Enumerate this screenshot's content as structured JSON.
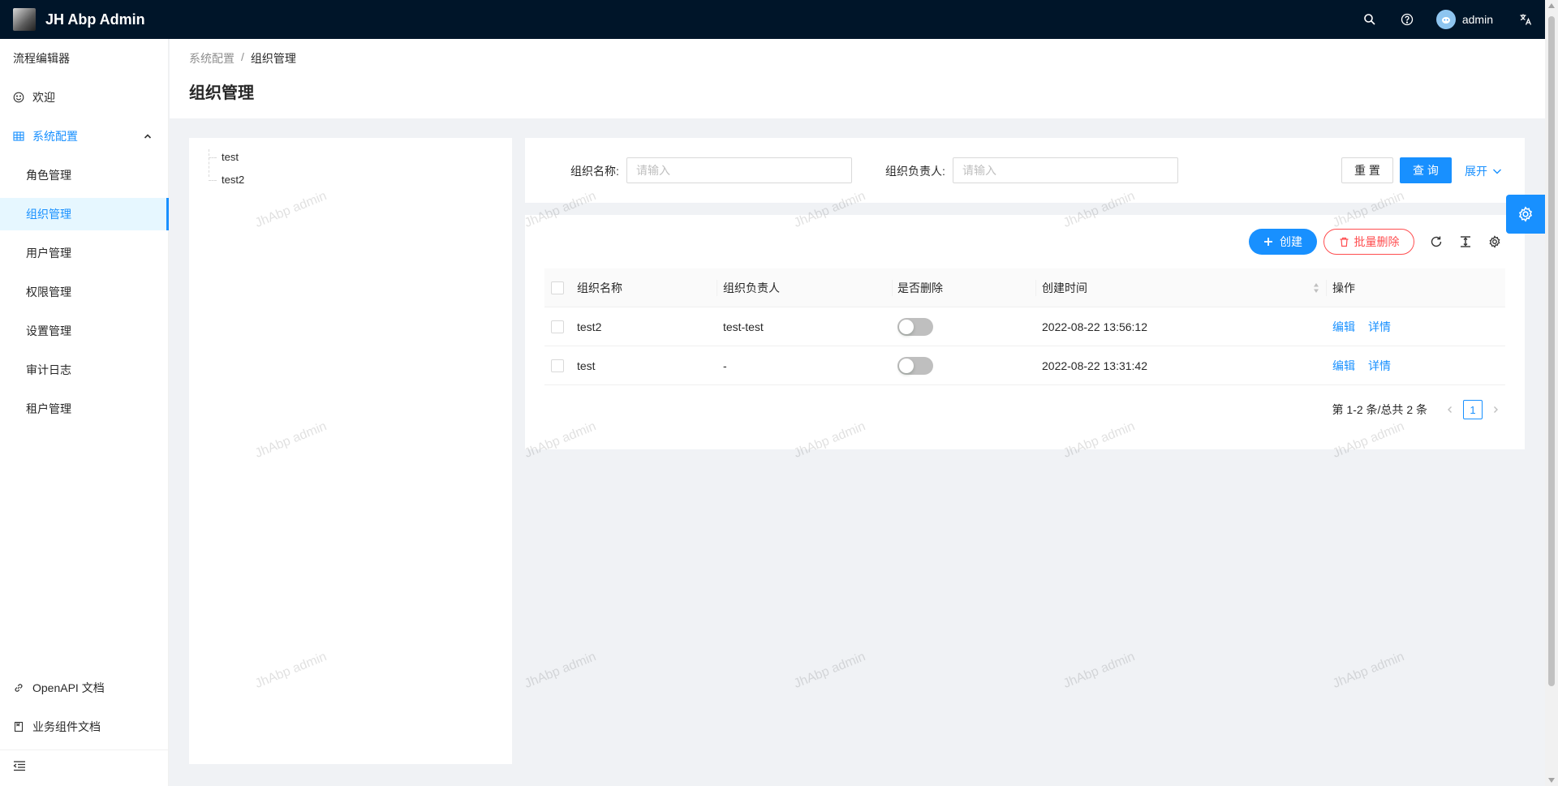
{
  "header": {
    "app_title": "JH Abp Admin",
    "user_name": "admin",
    "icons": [
      "search-icon",
      "question-circle-icon",
      "translate-icon"
    ]
  },
  "sidebar": {
    "items": [
      {
        "label": "流程编辑器",
        "icon": ""
      },
      {
        "label": "欢迎",
        "icon": "smile-icon"
      },
      {
        "label": "系统配置",
        "icon": "table-icon"
      },
      {
        "label": "角色管理"
      },
      {
        "label": "组织管理"
      },
      {
        "label": "用户管理"
      },
      {
        "label": "权限管理"
      },
      {
        "label": "设置管理"
      },
      {
        "label": "审计日志"
      },
      {
        "label": "租户管理"
      }
    ],
    "bottom": [
      {
        "label": "OpenAPI 文档",
        "icon": "link-icon"
      },
      {
        "label": "业务组件文档",
        "icon": "book-icon"
      }
    ]
  },
  "breadcrumb": {
    "parent": "系统配置",
    "separator": "/",
    "current": "组织管理"
  },
  "page_title": "组织管理",
  "tree": {
    "nodes": [
      "test",
      "test2"
    ]
  },
  "search": {
    "org_name_label": "组织名称:",
    "org_name_placeholder": "请输入",
    "leader_label": "组织负责人:",
    "leader_placeholder": "请输入",
    "reset_label": "重 置",
    "query_label": "查 询",
    "expand_label": "展开"
  },
  "toolbar": {
    "create_label": "创建",
    "batch_delete_label": "批量删除"
  },
  "table": {
    "columns": [
      "组织名称",
      "组织负责人",
      "是否删除",
      "创建时间",
      "操作"
    ],
    "rows": [
      {
        "name": "test2",
        "leader": "test-test",
        "deleted": false,
        "created": "2022-08-22 13:56:12",
        "edit": "编辑",
        "detail": "详情"
      },
      {
        "name": "test",
        "leader": "-",
        "deleted": false,
        "created": "2022-08-22 13:31:42",
        "edit": "编辑",
        "detail": "详情"
      }
    ]
  },
  "pagination": {
    "total_text": "第 1-2 条/总共 2 条",
    "current_page": "1"
  },
  "watermark_text": "JhAbp admin",
  "colors": {
    "primary": "#1890ff",
    "header_bg": "#001529",
    "danger": "#ff4d4f",
    "page_bg": "#f0f2f5"
  }
}
